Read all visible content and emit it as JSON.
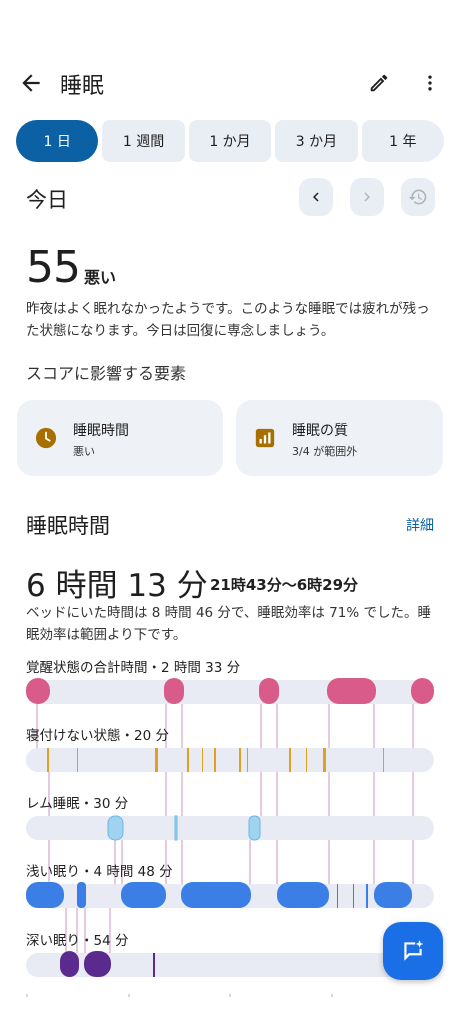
{
  "header": {
    "title": "睡眠",
    "back_icon": "arrow-back-icon",
    "edit_icon": "pencil-icon",
    "more_icon": "more-vert-icon"
  },
  "tabs": [
    {
      "label": "1 日",
      "active": true
    },
    {
      "label": "1 週間",
      "active": false
    },
    {
      "label": "1 か月",
      "active": false
    },
    {
      "label": "3 か月",
      "active": false
    },
    {
      "label": "1 年",
      "active": false
    }
  ],
  "date_nav": {
    "label": "今日",
    "prev_icon": "chevron-left-icon",
    "next_icon": "chevron-right-icon",
    "reset_icon": "history-icon"
  },
  "score": {
    "value": "55",
    "label": "悪い",
    "description": "昨夜はよく眠れなかったようです。このような睡眠では疲れが残った状態になります。今日は回復に専念しましょう。"
  },
  "factors": {
    "heading": "スコアに影響する要素",
    "items": [
      {
        "title": "睡眠時間",
        "subtitle": "悪い",
        "icon": "clock-icon"
      },
      {
        "title": "睡眠の質",
        "subtitle": "3/4 が範囲外",
        "icon": "bar-chart-icon"
      }
    ]
  },
  "sleep_time": {
    "title": "睡眠時間",
    "detail_link": "詳細",
    "duration": "6 時間 13 分",
    "range": "21時43分〜6時29分",
    "description": "ベッドにいた時間は 8 時間 46 分で、睡眠効率は 71% でした。睡眠効率は範囲より下です。"
  },
  "stage_labels": {
    "awake": "覚醒状態の合計時間・2 時間 33 分",
    "restless": "寝付けない状態・20 分",
    "rem": "レム睡眠・30 分",
    "light": "浅い眠り・4 時間 48 分",
    "deep": "深い眠り・54 分"
  },
  "colors": {
    "accent": "#0b61a4",
    "awake": "#d95b8a",
    "restless": "#e0a020",
    "rem": "#9fd3f0",
    "light": "#3b7ee6",
    "deep": "#5a2a8f",
    "track": "#e8ebf3",
    "factor_icon": "#a86f00"
  },
  "fab_icon": "chat-sparkle-icon"
}
